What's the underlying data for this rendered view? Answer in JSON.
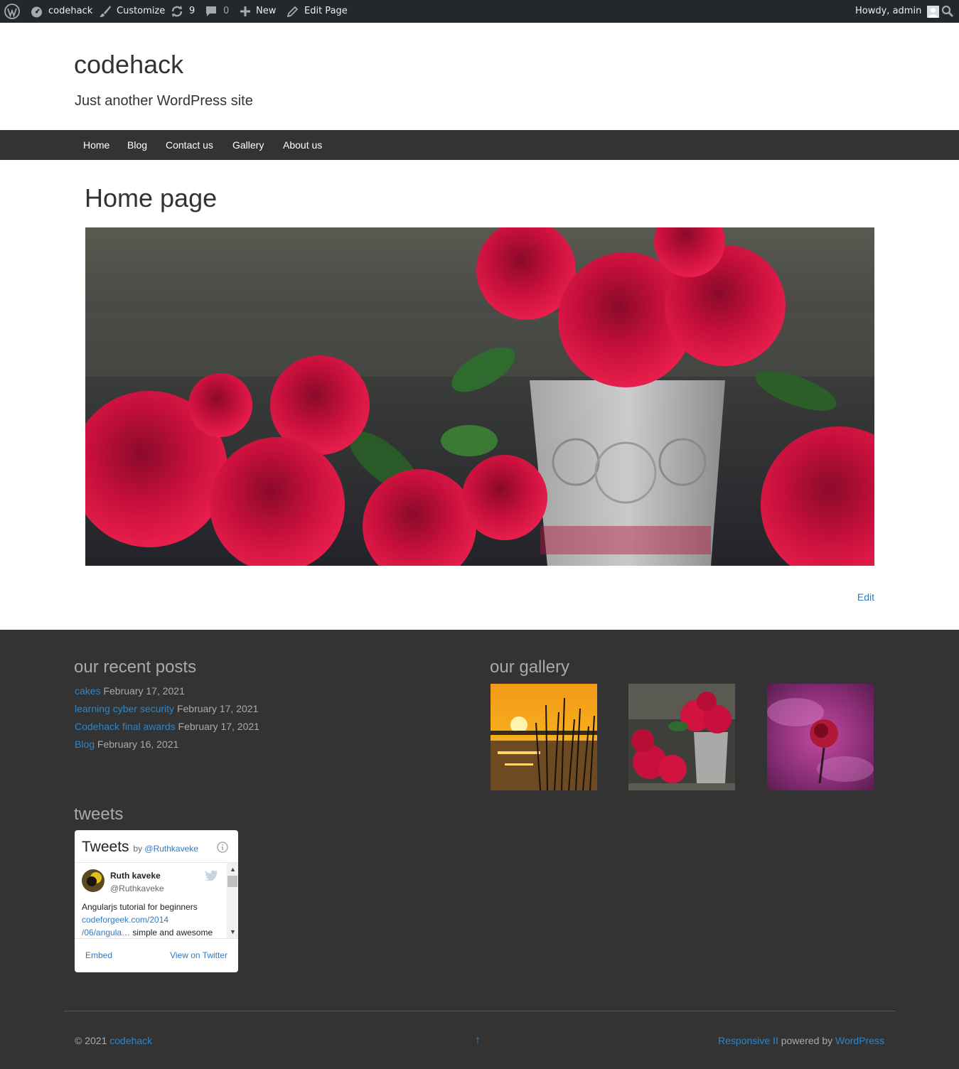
{
  "adminbar": {
    "site_name": "codehack",
    "customize": "Customize",
    "updates_count": "9",
    "comments_count": "0",
    "new": "New",
    "edit_page": "Edit Page",
    "howdy": "Howdy, admin"
  },
  "header": {
    "site_title": "codehack",
    "tagline": "Just another WordPress site"
  },
  "menu": {
    "items": [
      "Home",
      "Blog",
      "Contact us",
      "Gallery",
      "About us"
    ]
  },
  "content": {
    "title": "Home page",
    "edit": "Edit"
  },
  "recent_posts": {
    "title": "our recent posts",
    "posts": [
      {
        "link": "cakes",
        "date": "February 17, 2021"
      },
      {
        "link": "learning cyber security",
        "date": "February 17, 2021"
      },
      {
        "link": "Codehack final awards",
        "date": "February 17, 2021"
      },
      {
        "link": "Blog",
        "date": "February 16, 2021"
      }
    ]
  },
  "gallery": {
    "title": "our gallery"
  },
  "tweets": {
    "title": "tweets",
    "widget_title": "Tweets",
    "by": "by",
    "by_handle": "@Ruthkaveke",
    "author_name": "Ruth kaveke",
    "author_handle": "@Ruthkaveke",
    "text": "Angularjs tutorial for beginners",
    "link1": "codeforgeek.com/2014",
    "link2": "/06/angula…",
    "text2": "simple and awesome",
    "embed": "Embed",
    "view": "View on Twitter"
  },
  "footer": {
    "copyright_prefix": "© 2021",
    "copyright_link": "codehack",
    "arrow": "↑",
    "theme": "Responsive II",
    "powered": "powered by",
    "wordpress": "WordPress"
  },
  "colors": {
    "admin_bar": "#23282d",
    "menu_bg": "#333333",
    "footer_bg": "#333333",
    "link": "#2f79c0"
  }
}
